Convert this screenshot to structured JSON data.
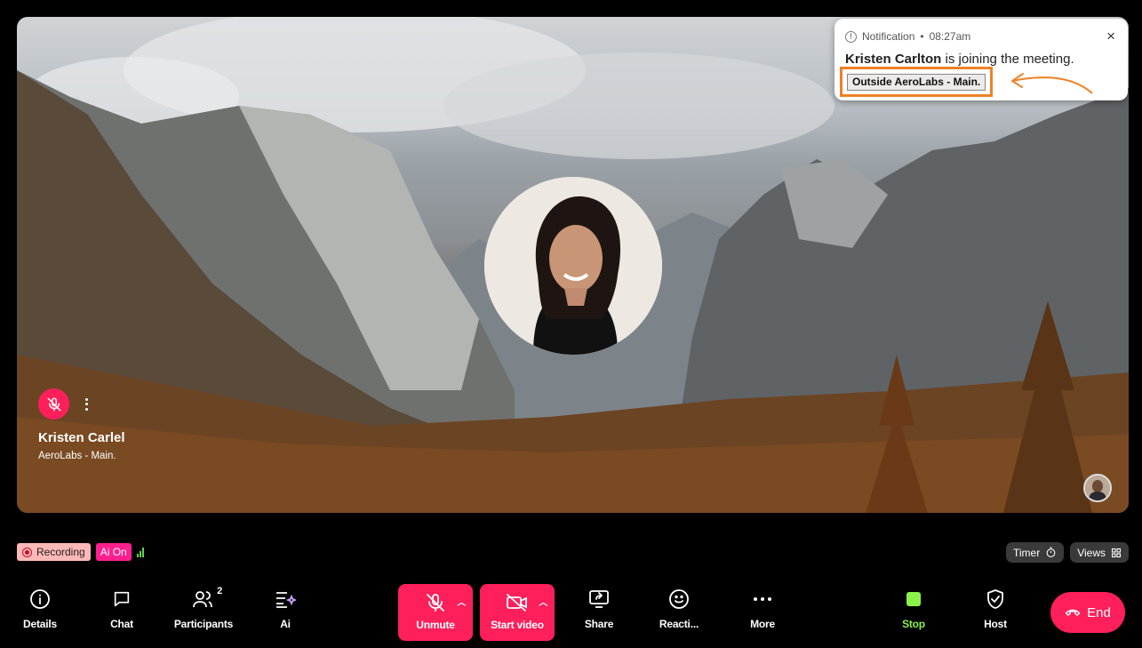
{
  "participant": {
    "name": "Kristen Carlel",
    "org": "AeroLabs - Main."
  },
  "notification": {
    "label": "Notification",
    "separator": "•",
    "time": "08:27am",
    "name": "Kristen Carlton",
    "message": "is joining the meeting.",
    "tag": "Outside AeroLabs - Main.",
    "close": "×"
  },
  "status": {
    "recording": "Recording",
    "ai": "Ai On",
    "timer": "Timer",
    "views": "Views"
  },
  "toolbar": {
    "details": "Details",
    "chat": "Chat",
    "participants": "Participants",
    "participants_count": "2",
    "ai": "Ai",
    "unmute": "Unmute",
    "start_video": "Start video",
    "share": "Share",
    "reactions": "Reacti...",
    "more": "More",
    "stop": "Stop",
    "host": "Host",
    "end": "End"
  },
  "colors": {
    "accent_pink": "#ff1f5a",
    "highlight_orange": "#f08025",
    "stop_green": "#8cf04a"
  }
}
